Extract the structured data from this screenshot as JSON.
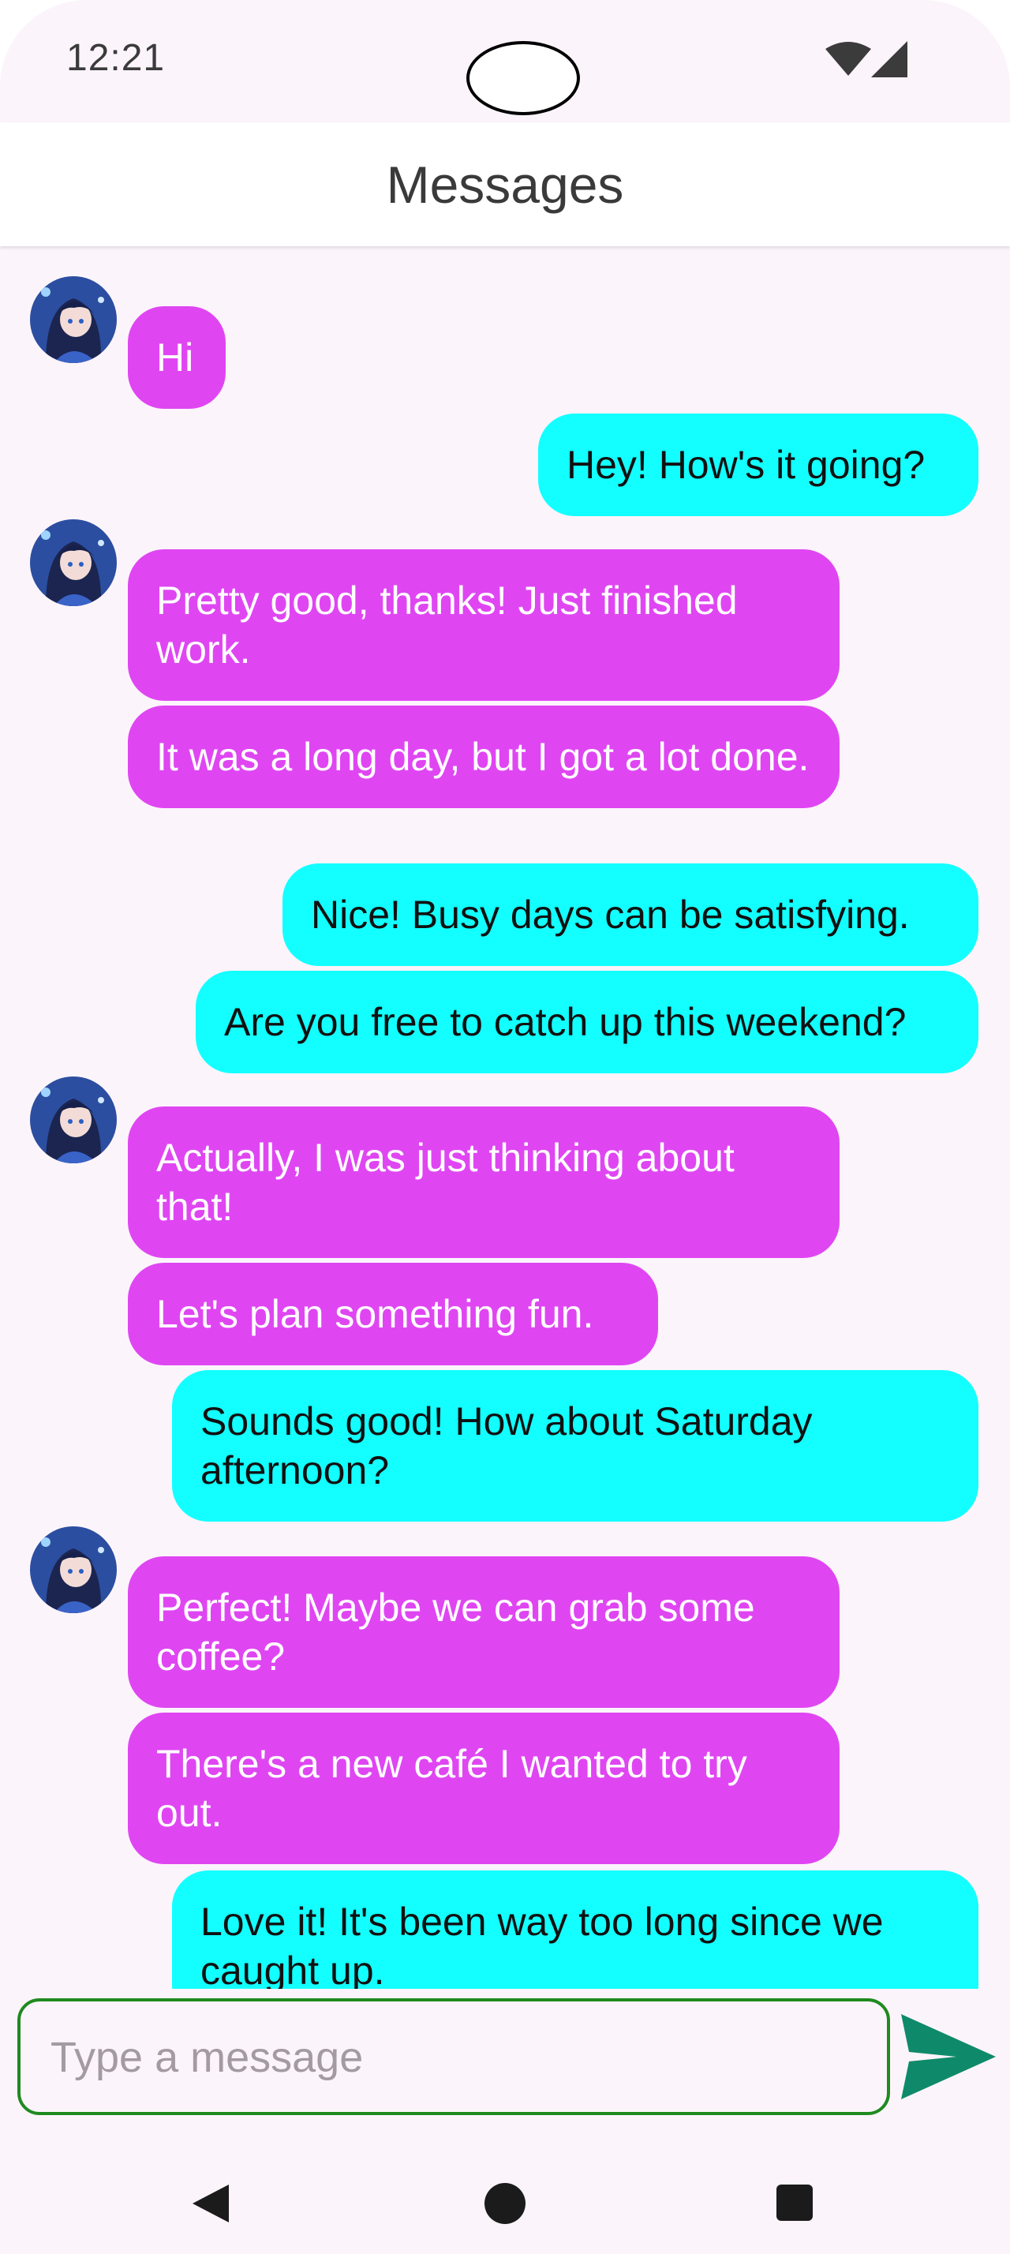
{
  "status_bar": {
    "time": "12:21",
    "icons": [
      "wifi-icon",
      "signal-icon"
    ]
  },
  "app_bar": {
    "title": "Messages"
  },
  "messages": [
    {
      "sender": "them",
      "text": "Hi"
    },
    {
      "sender": "me",
      "text": "Hey! How's it going?"
    },
    {
      "sender": "them",
      "text": "Pretty good, thanks! Just finished work."
    },
    {
      "sender": "them",
      "text": "It was a long day, but I got a lot done."
    },
    {
      "sender": "me",
      "text": "Nice! Busy days can be satisfying."
    },
    {
      "sender": "me",
      "text": "Are you free to catch up this weekend?"
    },
    {
      "sender": "them",
      "text": "Actually, I was just thinking about that!"
    },
    {
      "sender": "them",
      "text": "Let's plan something fun."
    },
    {
      "sender": "me",
      "text": "Sounds good! How about Saturday afternoon?"
    },
    {
      "sender": "them",
      "text": "Perfect! Maybe we can grab some coffee?"
    },
    {
      "sender": "them",
      "text": "There's a new café I wanted to try out."
    },
    {
      "sender": "me",
      "text": "Love it! It's been way too long since we caught up."
    }
  ],
  "composer": {
    "placeholder": "Type a message",
    "value": "",
    "send_icon": "send-icon"
  },
  "colors": {
    "incoming_bubble": "#df46f2",
    "outgoing_bubble": "#13ffff",
    "background": "#fcf4fb",
    "input_border": "#1f8a1f",
    "send_icon": "#0e8a6a"
  },
  "nav_bar": {
    "icons": [
      "back-icon",
      "home-icon",
      "recents-icon"
    ]
  }
}
